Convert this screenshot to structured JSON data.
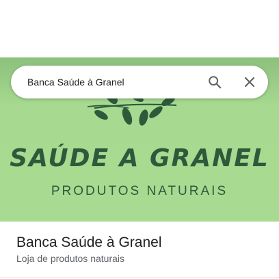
{
  "search": {
    "query": "Banca Saúde à Granel",
    "search_icon": "search-icon",
    "close_icon": "close-icon"
  },
  "hero_image": {
    "brand_title": "SAÚDE A GRANEL",
    "brand_subtitle": "PRODUTOS NATURAIS",
    "decoration_icon": "leaves-icon"
  },
  "place": {
    "name": "Banca Saúde à Granel",
    "category": "Loja de produtos naturais"
  },
  "colors": {
    "hero_background": "#a8db91",
    "brand_green": "#2c5a3b",
    "text_primary": "#202124",
    "text_secondary": "#5f6368"
  }
}
